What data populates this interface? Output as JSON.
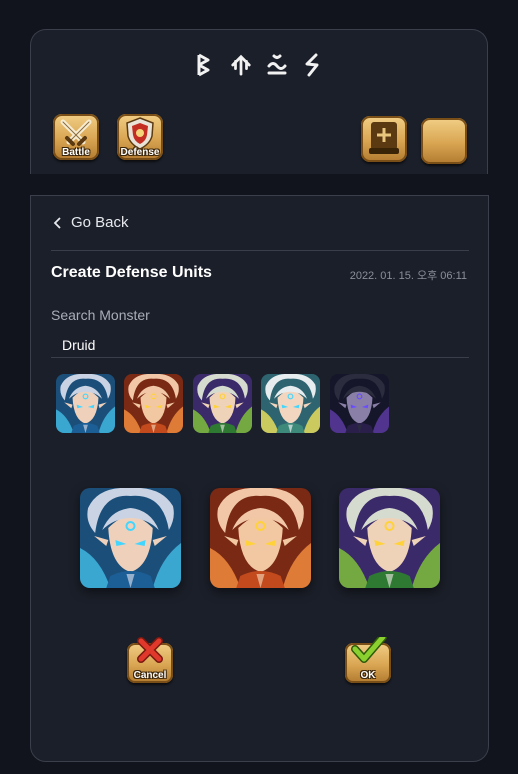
{
  "header": {
    "runes": [
      "ᛒ",
      "ᛏ",
      "ᛟ",
      "ᛋ"
    ],
    "buttons": {
      "battle_label": "Battle",
      "defense_label": "Defense"
    }
  },
  "nav": {
    "back_label": "Go Back"
  },
  "form": {
    "title": "Create Defense Units",
    "timestamp": "2022. 01. 15. 오후 06:11",
    "search_label": "Search Monster",
    "search_value": "Druid"
  },
  "results": [
    {
      "name": "druid-water",
      "element": "water",
      "accent": "#4fc3e8"
    },
    {
      "name": "druid-fire",
      "element": "fire",
      "accent": "#e8642b"
    },
    {
      "name": "druid-wind",
      "element": "wind",
      "accent": "#9bc53d"
    },
    {
      "name": "druid-light",
      "element": "light",
      "accent": "#e8e05a"
    },
    {
      "name": "druid-dark",
      "element": "dark",
      "accent": "#7a4fc8"
    }
  ],
  "selected": [
    {
      "name": "druid-water",
      "element": "water"
    },
    {
      "name": "druid-fire",
      "element": "fire"
    },
    {
      "name": "druid-wind",
      "element": "wind"
    }
  ],
  "actions": {
    "cancel_label": "Cancel",
    "ok_label": "OK"
  },
  "colors": {
    "background": "#11141c",
    "panel": "#1b1f29",
    "gold": "#d9a552",
    "cancel_red": "#e0392b",
    "ok_green": "#8ad12f"
  }
}
